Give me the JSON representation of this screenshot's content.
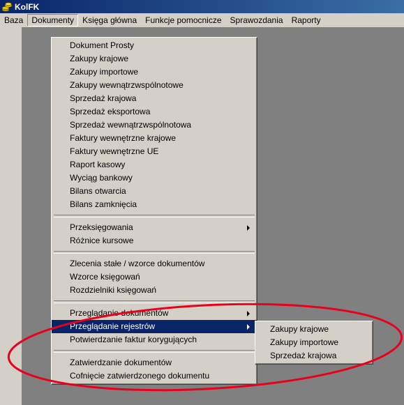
{
  "window": {
    "title": "KolFK",
    "icon": "coins-icon"
  },
  "menubar": [
    "Baza",
    "Dokumenty",
    "Księga główna",
    "Funkcje pomocnicze",
    "Sprawozdania",
    "Raporty"
  ],
  "dokumenty_menu": {
    "group1": [
      "Dokument Prosty",
      "Zakupy krajowe",
      "Zakupy importowe",
      "Zakupy wewnątrzwspólnotowe",
      "Sprzedaż krajowa",
      "Sprzedaż eksportowa",
      "Sprzedaż wewnątrzwspólnotowa",
      "Faktury wewnętrzne krajowe",
      "Faktury wewnętrzne UE",
      "Raport kasowy",
      "Wyciąg bankowy",
      "Bilans otwarcia",
      "Bilans zamknięcia"
    ],
    "group2": [
      "Przeksięgowania",
      "Różnice kursowe"
    ],
    "group3": [
      "Zlecenia stałe / wzorce dokumentów",
      "Wzorce księgowań",
      "Rozdzielniki księgowań"
    ],
    "group4": [
      "Przeglądanie dokumentów",
      "Przeglądanie rejestrów",
      "Potwierdzanie faktur korygujących"
    ],
    "group5": [
      "Zatwierdzanie dokumentów",
      "Cofnięcie zatwierdzonego dokumentu"
    ]
  },
  "submenu_rejestry": [
    "Zakupy krajowe",
    "Zakupy importowe",
    "Sprzedaż krajowa"
  ],
  "highlight_color": "#0a246a",
  "annotation_color": "#e8001c"
}
